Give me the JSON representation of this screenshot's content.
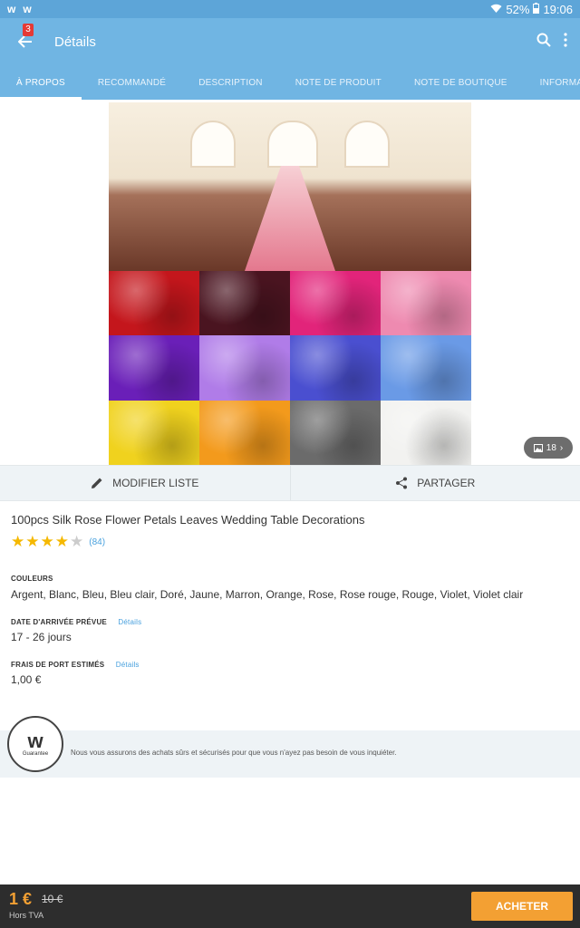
{
  "status_bar": {
    "battery": "52%",
    "time": "19:06",
    "app_icons": [
      "w",
      "w"
    ]
  },
  "appbar": {
    "title": "Détails",
    "cart_badge": "3"
  },
  "tabs": [
    {
      "label": "À PROPOS",
      "active": true
    },
    {
      "label": "RECOMMANDÉ"
    },
    {
      "label": "DESCRIPTION"
    },
    {
      "label": "NOTE DE PRODUIT"
    },
    {
      "label": "NOTE DE BOUTIQUE"
    },
    {
      "label": "INFORMATIO"
    }
  ],
  "gallery": {
    "count": "18"
  },
  "actions": {
    "edit_list": "MODIFIER LISTE",
    "share": "PARTAGER"
  },
  "product": {
    "name": "100pcs Silk Rose Flower Petals Leaves Wedding Table Decorations",
    "rating": 4,
    "rating_max": 5,
    "reviews": "(84)",
    "colors_label": "COULEURS",
    "colors_value": "Argent, Blanc, Bleu, Bleu clair, Doré, Jaune, Marron, Orange, Rose, Rose rouge, Rouge, Violet, Violet clair",
    "arrival_label": "DATE D'ARRIVÉE PRÉVUE",
    "arrival_link": "Détails",
    "arrival_value": "17 - 26 jours",
    "shipping_label": "FRAIS DE PORT ESTIMÉS",
    "shipping_link": "Détails",
    "shipping_value": "1,00 €"
  },
  "guarantee": {
    "logo_letter": "w",
    "logo_text": "Guarantee",
    "message": "Nous vous assurons des achats sûrs et sécurisés pour que vous n'ayez pas besoin de vous inquiéter."
  },
  "bottom": {
    "price": "1 €",
    "old_price": "10 €",
    "tax": "Hors TVA",
    "buy_label": "ACHETER"
  },
  "swatch_colors": [
    "#c4161c",
    "#4a1420",
    "#e2247a",
    "#ee8ab0",
    "#6a1fb8",
    "#b07ce8",
    "#4a4fd0",
    "#6a9ae6",
    "#f0d21e",
    "#f39a1c",
    "#6b6b6b",
    "#f2f2f0"
  ],
  "colors": {
    "accent": "#70b5e3",
    "buy": "#f3a033",
    "star": "#f5b800",
    "link": "#49a1de"
  }
}
